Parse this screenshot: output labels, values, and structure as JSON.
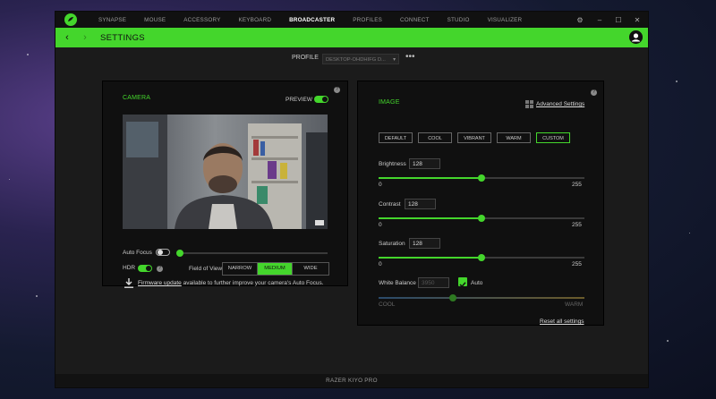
{
  "nav": {
    "items": [
      {
        "label": "SYNAPSE",
        "active": false
      },
      {
        "label": "MOUSE",
        "active": false
      },
      {
        "label": "ACCESSORY",
        "active": false
      },
      {
        "label": "KEYBOARD",
        "active": false
      },
      {
        "label": "BROADCASTER",
        "active": true
      },
      {
        "label": "PROFILES",
        "active": false
      },
      {
        "label": "CONNECT",
        "active": false
      },
      {
        "label": "STUDIO",
        "active": false
      },
      {
        "label": "VISUALIZER",
        "active": false
      }
    ],
    "window_controls": {
      "settings": "⚙",
      "minimize": "–",
      "maximize": "☐",
      "close": "✕"
    }
  },
  "header": {
    "title": "SETTINGS",
    "back": "‹",
    "forward": "›"
  },
  "profile": {
    "label": "PROFILE",
    "value": "DESKTOP-OHDHIFG D...",
    "more": "•••"
  },
  "camera": {
    "heading": "CAMERA",
    "preview_label": "PREVIEW",
    "preview_on": true,
    "auto_focus_label": "Auto Focus",
    "auto_focus_on": false,
    "focus_level": 0.0,
    "hdr_label": "HDR",
    "hdr_on": true,
    "fov_label": "Field of View",
    "fov_options": [
      "NARROW",
      "MEDIUM",
      "WIDE"
    ],
    "fov_selected": "MEDIUM",
    "firmware_link": "Firmware update",
    "firmware_text": " available to further improve your camera's Auto Focus."
  },
  "image": {
    "heading": "IMAGE",
    "advanced_link": "Advanced Settings",
    "presets": [
      "DEFAULT",
      "COOL",
      "VIBRANT",
      "WARM",
      "CUSTOM"
    ],
    "preset_selected": "CUSTOM",
    "brightness": {
      "label": "Brightness",
      "value": "128",
      "min": "0",
      "max": "255",
      "level": 128
    },
    "contrast": {
      "label": "Contrast",
      "value": "128",
      "min": "0",
      "max": "255",
      "level": 128
    },
    "saturation": {
      "label": "Saturation",
      "value": "128",
      "min": "0",
      "max": "255",
      "level": 128
    },
    "white_balance": {
      "label": "White Balance",
      "value": "3950",
      "auto_label": "Auto",
      "auto_on": true,
      "cool": "COOL",
      "warm": "WARM",
      "level": 0.36
    },
    "reset_link": "Reset all settings"
  },
  "footer": {
    "device": "RAZER KIYO PRO"
  },
  "colors": {
    "accent": "#44d62c",
    "panel": "#101010",
    "window": "#1b1b1b"
  }
}
